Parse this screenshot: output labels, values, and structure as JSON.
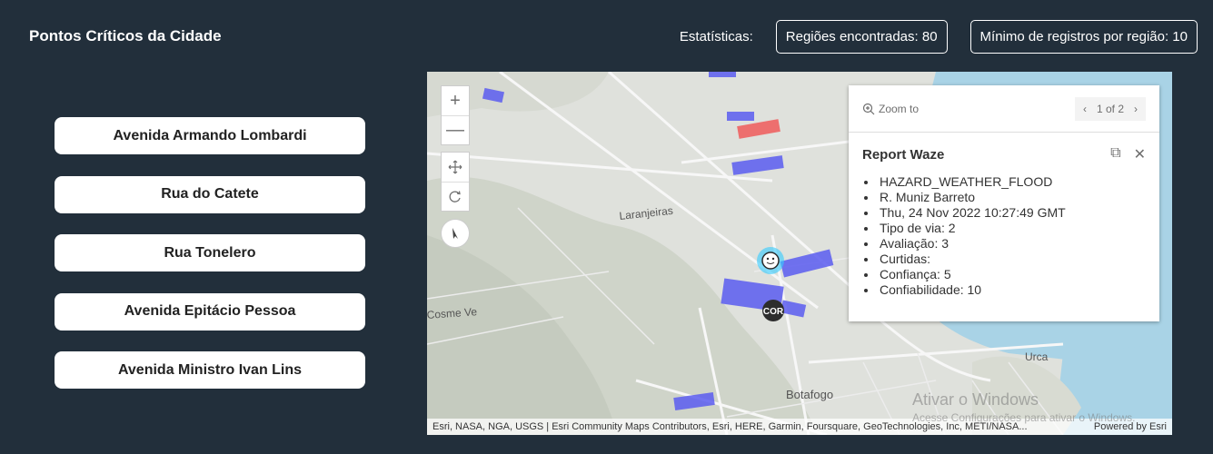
{
  "header": {
    "title": "Pontos Críticos da Cidade",
    "stats_label": "Estatísticas:",
    "regions_found": "Regiões encontradas: 80",
    "min_records": "Mínimo de registros por região: 10"
  },
  "streets": [
    {
      "label": "Avenida Armando Lombardi"
    },
    {
      "label": "Rua do Catete"
    },
    {
      "label": "Rua Tonelero"
    },
    {
      "label": "Avenida Epitácio Pessoa"
    },
    {
      "label": "Avenida Ministro Ivan Lins"
    }
  ],
  "map": {
    "labels": {
      "laranjeiras": "Laranjeiras",
      "botafogo": "Botafogo",
      "urca": "Urca",
      "cosme_velho": "Cosme Ve",
      "cor_marker": "COR"
    },
    "controls": {
      "zoom_in": "+",
      "zoom_out": "—"
    },
    "attribution": "Esri, NASA, NGA, USGS | Esri Community Maps Contributors, Esri, HERE, Garmin, Foursquare, GeoTechnologies, Inc, METI/NASA...",
    "powered_by": "Powered by Esri",
    "colors": {
      "region": "#5a5cf0",
      "highlight": "#f05a5a",
      "waze": "#33ccff"
    }
  },
  "popup": {
    "zoom_to": "Zoom to",
    "pager": "1 of 2",
    "title": "Report Waze",
    "items": [
      "HAZARD_WEATHER_FLOOD",
      "R. Muniz Barreto",
      "Thu, 24 Nov 2022 10:27:49 GMT",
      "Tipo de via: 2",
      "Avaliação: 3",
      "Curtidas:",
      "Confiança: 5",
      "Confiabilidade: 10"
    ]
  },
  "watermark": {
    "line1": "Ativar o Windows",
    "line2": "Acesse Configurações para ativar o Windows."
  }
}
